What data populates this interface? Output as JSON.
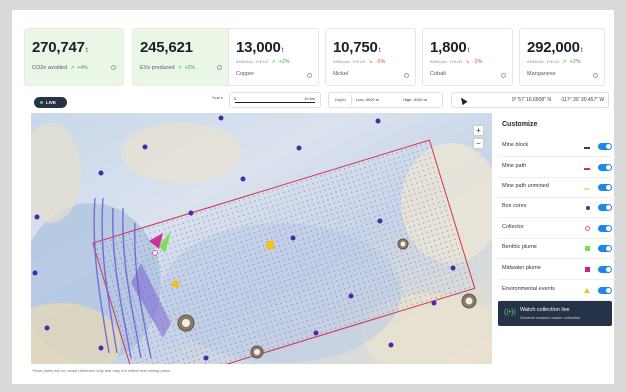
{
  "stats": [
    {
      "value": "270,747",
      "unit": "t",
      "sub": "",
      "label": "CO2e avoided",
      "delta": "+4%",
      "dir": "up",
      "green": true
    },
    {
      "value": "245,621",
      "unit": "",
      "sub": "",
      "label": "EVs produced",
      "delta": "+2%",
      "dir": "up",
      "green": true
    },
    {
      "value": "13,000",
      "unit": "t",
      "sub": "ANNUAL YIELD",
      "label": "Copper",
      "delta": "+2%",
      "dir": "up",
      "green": false
    },
    {
      "value": "10,750",
      "unit": "t",
      "sub": "ANNUAL YIELD",
      "label": "Nickel",
      "delta": "-5%",
      "dir": "down",
      "green": false
    },
    {
      "value": "1,800",
      "unit": "t",
      "sub": "ANNUAL YIELD",
      "label": "Cobalt",
      "delta": "-3%",
      "dir": "down",
      "green": false
    },
    {
      "value": "292,000",
      "unit": "t",
      "sub": "ANNUAL YIELD",
      "label": "Manganese",
      "delta": "+2%",
      "dir": "up",
      "green": false
    }
  ],
  "live_label": "LIVE",
  "scale": {
    "label": "Scal e",
    "start": "0",
    "end": "10 km"
  },
  "depth": {
    "label": "Depth",
    "low": "Low -4000 m",
    "high": "High -4100 m"
  },
  "coords": {
    "lat": "9° 57' 16.6908\" N",
    "lon": "-117° 30' 30.457\" W"
  },
  "zoom": {
    "in": "+",
    "out": "−"
  },
  "customize": {
    "title": "Customize",
    "items": [
      {
        "label": "Mine block",
        "indicator": "dash",
        "color": "#3a3f4a"
      },
      {
        "label": "Mine path",
        "indicator": "dash",
        "color": "#d2334a"
      },
      {
        "label": "Mine path unmined",
        "indicator": "dash",
        "color": "#e8e38a"
      },
      {
        "label": "Box cores",
        "indicator": "dot",
        "color": "#4a2aa8"
      },
      {
        "label": "Collector",
        "indicator": "ring",
        "color": "#e05bb8"
      },
      {
        "label": "Benthic plume",
        "indicator": "square",
        "color": "#7bdc4c"
      },
      {
        "label": "Midwater plume",
        "indicator": "square",
        "color": "#c8208f"
      },
      {
        "label": "Environmental events",
        "indicator": "triangle",
        "color": "#f2c21b"
      }
    ]
  },
  "watch": {
    "title": "Watch collection live",
    "subtitle": "Observe seabed nodule collection"
  },
  "footnote": "*Mine paths are for visual reference only and may not reflect real mining plans.",
  "colors": {
    "accent": "#1e88e5",
    "dark": "#263247",
    "green_card": "#eaf7e6",
    "up": "#3aa33b",
    "down": "#e0464a"
  }
}
